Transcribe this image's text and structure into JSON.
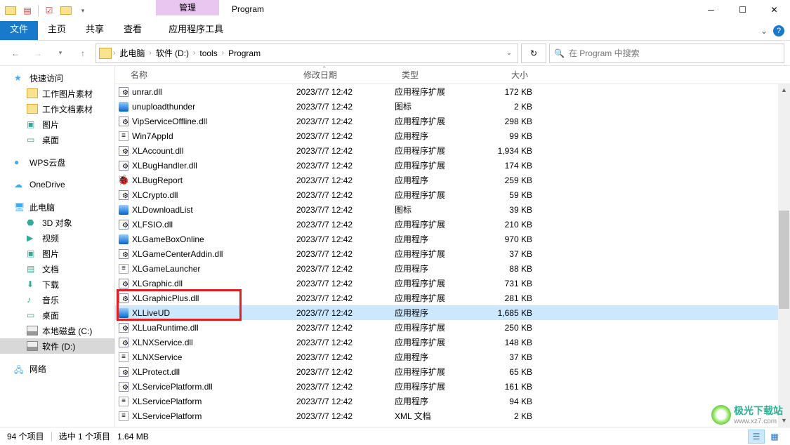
{
  "window": {
    "title": "Program",
    "context_tab": "管理"
  },
  "ribbon": {
    "tabs": [
      "文件",
      "主页",
      "共享",
      "查看"
    ],
    "tool_tab": "应用程序工具"
  },
  "breadcrumb": {
    "parts": [
      "此电脑",
      "软件 (D:)",
      "tools",
      "Program"
    ],
    "search_placeholder": "在 Program 中搜索"
  },
  "sidebar": {
    "groups": [
      {
        "label": "快速访问",
        "icon": "star",
        "items": [
          "工作图片素材",
          "工作文档素材",
          "图片",
          "桌面"
        ]
      },
      {
        "label": "WPS云盘",
        "icon": "wps",
        "items": []
      },
      {
        "label": "OneDrive",
        "icon": "onedrive",
        "items": []
      },
      {
        "label": "此电脑",
        "icon": "pc",
        "items": [
          "3D 对象",
          "视频",
          "图片",
          "文档",
          "下载",
          "音乐",
          "桌面",
          "本地磁盘 (C:)",
          "软件 (D:)"
        ]
      },
      {
        "label": "网络",
        "icon": "network",
        "items": []
      }
    ],
    "selected": "软件 (D:)"
  },
  "columns": {
    "name": "名称",
    "date": "修改日期",
    "type": "类型",
    "size": "大小"
  },
  "files": [
    {
      "icon": "dll",
      "name": "unrar.dll",
      "date": "2023/7/7 12:42",
      "type": "应用程序扩展",
      "size": "172 KB"
    },
    {
      "icon": "exe",
      "name": "unuploadthunder",
      "date": "2023/7/7 12:42",
      "type": "图标",
      "size": "2 KB"
    },
    {
      "icon": "dll",
      "name": "VipServiceOffline.dll",
      "date": "2023/7/7 12:42",
      "type": "应用程序扩展",
      "size": "298 KB"
    },
    {
      "icon": "list",
      "name": "Win7AppId",
      "date": "2023/7/7 12:42",
      "type": "应用程序",
      "size": "99 KB"
    },
    {
      "icon": "dll",
      "name": "XLAccount.dll",
      "date": "2023/7/7 12:42",
      "type": "应用程序扩展",
      "size": "1,934 KB"
    },
    {
      "icon": "dll",
      "name": "XLBugHandler.dll",
      "date": "2023/7/7 12:42",
      "type": "应用程序扩展",
      "size": "174 KB"
    },
    {
      "icon": "bug",
      "name": "XLBugReport",
      "date": "2023/7/7 12:42",
      "type": "应用程序",
      "size": "259 KB"
    },
    {
      "icon": "dll",
      "name": "XLCrypto.dll",
      "date": "2023/7/7 12:42",
      "type": "应用程序扩展",
      "size": "59 KB"
    },
    {
      "icon": "exe",
      "name": "XLDownloadList",
      "date": "2023/7/7 12:42",
      "type": "图标",
      "size": "39 KB"
    },
    {
      "icon": "dll",
      "name": "XLFSIO.dll",
      "date": "2023/7/7 12:42",
      "type": "应用程序扩展",
      "size": "210 KB"
    },
    {
      "icon": "exe",
      "name": "XLGameBoxOnline",
      "date": "2023/7/7 12:42",
      "type": "应用程序",
      "size": "970 KB"
    },
    {
      "icon": "dll",
      "name": "XLGameCenterAddin.dll",
      "date": "2023/7/7 12:42",
      "type": "应用程序扩展",
      "size": "37 KB"
    },
    {
      "icon": "list",
      "name": "XLGameLauncher",
      "date": "2023/7/7 12:42",
      "type": "应用程序",
      "size": "88 KB"
    },
    {
      "icon": "dll",
      "name": "XLGraphic.dll",
      "date": "2023/7/7 12:42",
      "type": "应用程序扩展",
      "size": "731 KB"
    },
    {
      "icon": "dll",
      "name": "XLGraphicPlus.dll",
      "date": "2023/7/7 12:42",
      "type": "应用程序扩展",
      "size": "281 KB"
    },
    {
      "icon": "exe",
      "name": "XLLiveUD",
      "date": "2023/7/7 12:42",
      "type": "应用程序",
      "size": "1,685 KB",
      "selected": true
    },
    {
      "icon": "dll",
      "name": "XLLuaRuntime.dll",
      "date": "2023/7/7 12:42",
      "type": "应用程序扩展",
      "size": "250 KB"
    },
    {
      "icon": "dll",
      "name": "XLNXService.dll",
      "date": "2023/7/7 12:42",
      "type": "应用程序扩展",
      "size": "148 KB"
    },
    {
      "icon": "list",
      "name": "XLNXService",
      "date": "2023/7/7 12:42",
      "type": "应用程序",
      "size": "37 KB"
    },
    {
      "icon": "dll",
      "name": "XLProtect.dll",
      "date": "2023/7/7 12:42",
      "type": "应用程序扩展",
      "size": "65 KB"
    },
    {
      "icon": "dll",
      "name": "XLServicePlatform.dll",
      "date": "2023/7/7 12:42",
      "type": "应用程序扩展",
      "size": "161 KB"
    },
    {
      "icon": "list",
      "name": "XLServicePlatform",
      "date": "2023/7/7 12:42",
      "type": "应用程序",
      "size": "94 KB"
    },
    {
      "icon": "list",
      "name": "XLServicePlatform",
      "date": "2023/7/7 12:42",
      "type": "XML 文档",
      "size": "2 KB"
    }
  ],
  "status": {
    "count": "94 个项目",
    "selected": "选中 1 个项目",
    "size": "1.64 MB"
  },
  "watermark": {
    "text": "极光下载站",
    "url": "www.xz7.com"
  },
  "highlight_row": 15
}
